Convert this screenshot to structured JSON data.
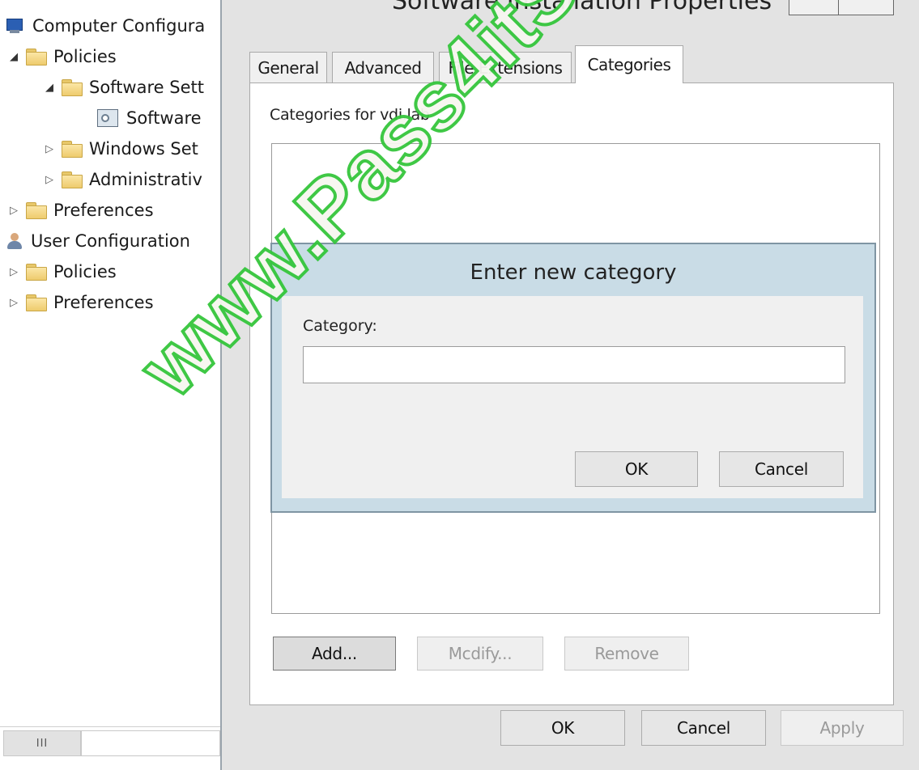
{
  "tree": {
    "items": [
      {
        "label": "Computer Configura",
        "icon": "computer-icon",
        "expander": ""
      },
      {
        "label": "Policies",
        "icon": "folder-icon",
        "expander": "expanded"
      },
      {
        "label": "Software Sett",
        "icon": "folder-icon",
        "expander": "expanded"
      },
      {
        "label": "Software",
        "icon": "software-installation-icon",
        "expander": ""
      },
      {
        "label": "Windows Set",
        "icon": "folder-icon",
        "expander": "collapsed"
      },
      {
        "label": "Administrativ",
        "icon": "folder-icon",
        "expander": "collapsed"
      },
      {
        "label": "Preferences",
        "icon": "folder-icon",
        "expander": "collapsed"
      },
      {
        "label": "User Configuration",
        "icon": "user-icon",
        "expander": ""
      },
      {
        "label": "Policies",
        "icon": "folder-icon",
        "expander": "collapsed"
      },
      {
        "label": "Preferences",
        "icon": "folder-icon",
        "expander": "collapsed"
      }
    ],
    "scrollbar_grip": "III"
  },
  "window": {
    "title": "Software Installation Properties",
    "tabs": [
      {
        "label": "General",
        "active": false
      },
      {
        "label": "Advanced",
        "active": false
      },
      {
        "label": "File Extensions",
        "active": false
      },
      {
        "label": "Categories",
        "active": true
      }
    ],
    "page_caption": "Categories for vdi.lab",
    "buttons": {
      "add": "Add...",
      "modify": "Mcdify...",
      "remove": "Remove",
      "ok": "OK",
      "cancel": "Cancel",
      "apply": "Apply"
    }
  },
  "dialog": {
    "title": "Enter new category",
    "category_label": "Category:",
    "category_value": "",
    "ok": "OK",
    "cancel": "Cancel"
  },
  "watermark": "www.Pass4itSure.com",
  "colors": {
    "dialog_frame": "#c9dce6",
    "watermark_outline": "#35c63c",
    "window_bg": "#e3e3e3"
  }
}
